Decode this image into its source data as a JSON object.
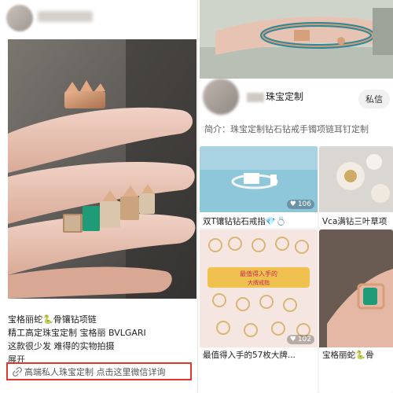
{
  "left_post": {
    "caption_lines": [
      "宝格丽蛇🐍骨镶钻项链",
      "精工高定珠宝定制 宝格丽 BVLGARI",
      "这款很少发 难得的实物拍摄"
    ],
    "expand_label": "展开",
    "consult_text": "高端私人珠宝定制 点击这里微信详询"
  },
  "right_profile": {
    "name_suffix": "珠宝定制",
    "dm_button": "私信",
    "intro": "简介：珠宝定制钻石钻戒手镯项链耳钉定制"
  },
  "cards": [
    {
      "title": "双T镶钻钻石戒指💎💍",
      "likes": "106"
    },
    {
      "title": "Vca满钻三叶草项"
    },
    {
      "title": "最值得入手的57枚大牌...",
      "likes": "102"
    },
    {
      "title": "宝格丽蛇🐍骨"
    }
  ],
  "promo_overlay": {
    "line1": "最值得入手的",
    "line2": "大牌戒指"
  },
  "colors": {
    "highlight_border": "#e0392b",
    "dm_button_bg": "#f1f1f1"
  },
  "icons": [
    "link-icon",
    "heart-icon"
  ]
}
